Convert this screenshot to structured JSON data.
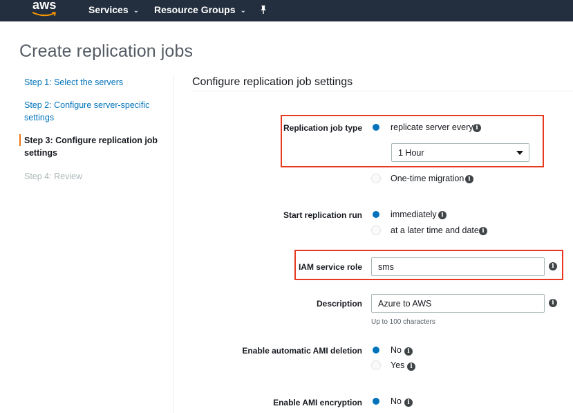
{
  "nav": {
    "logo": "aws",
    "services": "Services",
    "resource_groups": "Resource Groups"
  },
  "page": {
    "title": "Create replication jobs"
  },
  "steps": [
    {
      "label": "Step 1: Select the servers",
      "state": "link"
    },
    {
      "label": "Step 2: Configure server-specific settings",
      "state": "link"
    },
    {
      "label": "Step 3: Configure replication job settings",
      "state": "current"
    },
    {
      "label": "Step 4: Review",
      "state": "disabled"
    }
  ],
  "form": {
    "section_title": "Configure replication job settings",
    "replication_job_type": {
      "label": "Replication job type",
      "option_recurring": "replicate server every",
      "interval_selected": "1 Hour",
      "option_one_time": "One-time migration",
      "selected": "recurring"
    },
    "start_replication_run": {
      "label": "Start replication run",
      "option_immediately": "immediately",
      "option_later": "at a later time and date",
      "selected": "immediately"
    },
    "iam_service_role": {
      "label": "IAM service role",
      "value": "sms"
    },
    "description": {
      "label": "Description",
      "value": "Azure to AWS",
      "hint": "Up to 100 characters"
    },
    "ami_deletion": {
      "label": "Enable automatic AMI deletion",
      "option_no": "No",
      "option_yes": "Yes",
      "selected": "No"
    },
    "ami_encryption": {
      "label": "Enable AMI encryption",
      "option_no": "No",
      "selected": "No"
    }
  },
  "colors": {
    "nav_bg": "#232f3e",
    "link": "#0073bb",
    "radio_selected": "#0073bb",
    "current_step_marker": "#ec7211",
    "highlight_box": "#e8381f"
  },
  "icons": [
    "aws-logo",
    "chevron-down-icon",
    "pin-icon",
    "info-icon",
    "select-caret-icon"
  ]
}
